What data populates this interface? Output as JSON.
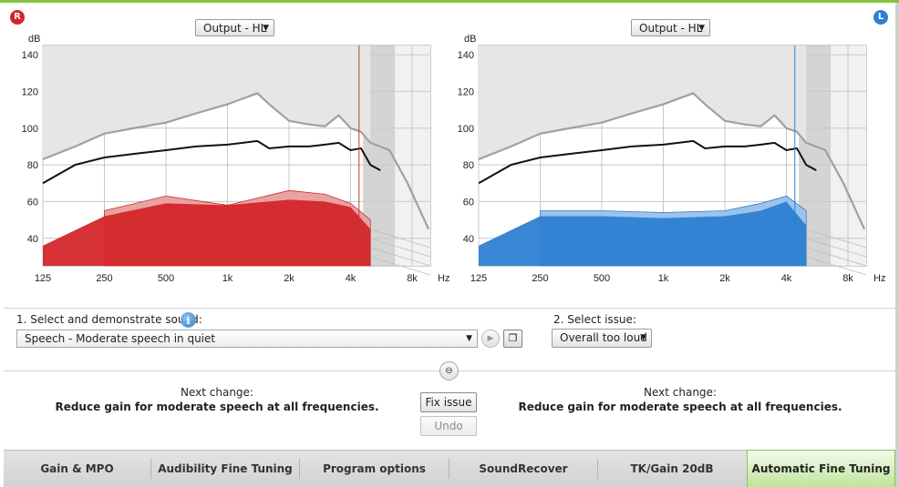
{
  "side_labels": {
    "right": "R",
    "left": "L"
  },
  "colors": {
    "right_ear": "#d4262a",
    "left_ear": "#2d7fd3",
    "active_tab": "#bfe49a",
    "accent": "#86c23e"
  },
  "charts": {
    "right": {
      "dropdown": "Output - HL"
    },
    "left": {
      "dropdown": "Output - HL"
    }
  },
  "chart_data": [
    {
      "type": "area",
      "ear": "right",
      "ylabel": "dB",
      "xunit": "Hz",
      "x_ticks": [
        "125",
        "250",
        "500",
        "1k",
        "2k",
        "4k",
        "8k"
      ],
      "y_ticks": [
        "140",
        "120",
        "100",
        "80",
        "60",
        "40"
      ],
      "ylim": [
        25,
        145
      ],
      "series": [
        {
          "freq": [
            125,
            180,
            250,
            350,
            500,
            700,
            1000,
            1400,
            1600,
            2000,
            2500,
            3000,
            3500,
            4000,
            4500,
            5000
          ],
          "values": [
            83,
            90,
            97,
            100,
            103,
            108,
            113,
            119,
            113,
            104,
            102,
            101,
            107,
            100,
            98,
            92
          ]
        },
        {
          "freq": [
            125,
            180,
            250,
            350,
            500,
            700,
            1000,
            1400,
            1600,
            2000,
            2500,
            3000,
            3500,
            4000,
            4500,
            5000
          ],
          "values": [
            70,
            80,
            84,
            86,
            88,
            90,
            91,
            93,
            89,
            90,
            90,
            91,
            92,
            88,
            89,
            80
          ]
        },
        {
          "freq": [
            125,
            250,
            500,
            1000,
            2000,
            3000,
            4000,
            5000
          ],
          "values": [
            36,
            52,
            59,
            58,
            61,
            60,
            57,
            45
          ]
        },
        {
          "freq": [
            250,
            500,
            1000,
            2000,
            3000,
            4000,
            5000
          ],
          "values": [
            55,
            63,
            58,
            66,
            64,
            59,
            50
          ]
        }
      ],
      "marker_freq": 4400
    },
    {
      "type": "area",
      "ear": "left",
      "ylabel": "dB",
      "xunit": "Hz",
      "x_ticks": [
        "125",
        "250",
        "500",
        "1k",
        "2k",
        "4k",
        "8k"
      ],
      "y_ticks": [
        "140",
        "120",
        "100",
        "80",
        "60",
        "40"
      ],
      "ylim": [
        25,
        145
      ],
      "series": [
        {
          "freq": [
            125,
            180,
            250,
            350,
            500,
            700,
            1000,
            1400,
            1600,
            2000,
            2500,
            3000,
            3500,
            4000,
            4500,
            5000
          ],
          "values": [
            83,
            90,
            97,
            100,
            103,
            108,
            113,
            119,
            113,
            104,
            102,
            101,
            107,
            100,
            98,
            92
          ]
        },
        {
          "freq": [
            125,
            180,
            250,
            350,
            500,
            700,
            1000,
            1400,
            1600,
            2000,
            2500,
            3000,
            3500,
            4000,
            4500,
            5000
          ],
          "values": [
            70,
            80,
            84,
            86,
            88,
            90,
            91,
            93,
            89,
            90,
            90,
            91,
            92,
            88,
            89,
            80
          ]
        },
        {
          "freq": [
            125,
            250,
            500,
            1000,
            2000,
            3000,
            4000,
            5000
          ],
          "values": [
            36,
            52,
            52,
            51,
            52,
            55,
            60,
            47
          ]
        },
        {
          "freq": [
            250,
            500,
            1000,
            2000,
            3000,
            4000,
            5000
          ],
          "values": [
            55,
            55,
            54,
            55,
            59,
            63,
            55
          ]
        }
      ],
      "marker_freq": 4400
    }
  ],
  "sound": {
    "label": "1. Select and demonstrate sound:",
    "info_icon": "i",
    "selected": "Speech - Moderate speech in quiet",
    "play_icon": "▶",
    "window_icon": "❐"
  },
  "issue": {
    "label": "2. Select issue:",
    "selected": "Overall too loud"
  },
  "link_icon": "⊖",
  "next_change": {
    "right": {
      "title": "Next change:",
      "text": "Reduce gain for moderate speech at all frequencies."
    },
    "left": {
      "title": "Next change:",
      "text": "Reduce gain for moderate speech at all frequencies."
    }
  },
  "buttons": {
    "fix": "Fix issue",
    "undo": "Undo"
  },
  "tabs": [
    {
      "label": "Gain & MPO"
    },
    {
      "label": "Audibility Fine Tuning"
    },
    {
      "label": "Program options"
    },
    {
      "label": "SoundRecover"
    },
    {
      "label": "TK/Gain 20dB"
    },
    {
      "label": "Automatic Fine Tuning"
    }
  ]
}
